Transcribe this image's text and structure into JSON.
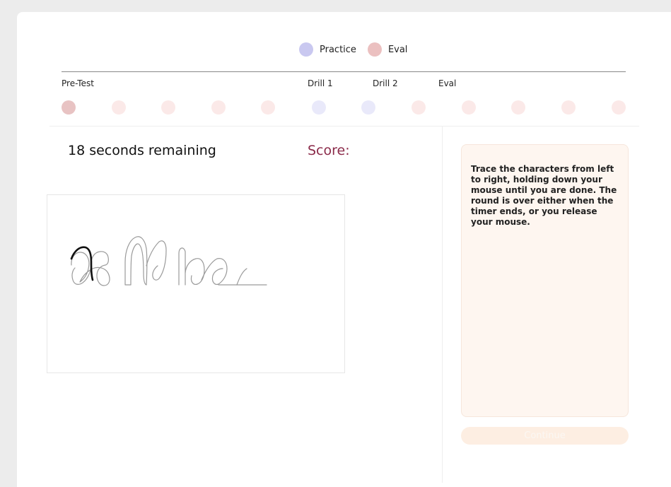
{
  "legend": [
    {
      "label": "Practice",
      "color": "#c9c8f0"
    },
    {
      "label": "Eval",
      "color": "#ebc0c0"
    }
  ],
  "stages": {
    "pretest": "Pre-Test",
    "drill1": "Drill 1",
    "drill2": "Drill 2",
    "eval": "Eval"
  },
  "steps": [
    {
      "color": "#e8c3c3",
      "state": "current"
    },
    {
      "color": "#fbe9e8"
    },
    {
      "color": "#fbe9e8"
    },
    {
      "color": "#fbe9e8"
    },
    {
      "color": "#fbe9e8"
    },
    {
      "color": "#e9e9fa"
    },
    {
      "color": "#e9e9fa"
    },
    {
      "color": "#fbe9e8"
    },
    {
      "color": "#fbe9e8"
    },
    {
      "color": "#fbe9e8"
    },
    {
      "color": "#fbe9e8"
    },
    {
      "color": "#fbe9e8"
    }
  ],
  "status": {
    "timer": "18 seconds remaining",
    "score_label": "Score:"
  },
  "instructions": "Trace the characters from left to right, holding down your mouse until you are done. The round is over either when the timer ends, or you release your mouse.",
  "continue_label": "Continue"
}
